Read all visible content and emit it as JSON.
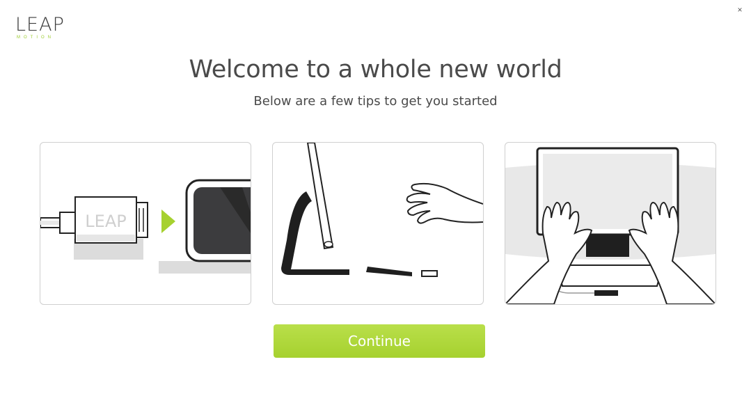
{
  "window": {
    "close_icon": "×"
  },
  "logo": {
    "word": "LEAP",
    "sub": "MOTION"
  },
  "header": {
    "title": "Welcome to a whole new world",
    "subtitle": "Below are a few tips to get you started"
  },
  "tips": [
    {
      "illustration": "usb-plug-into-device",
      "plug_label": "LEAP"
    },
    {
      "illustration": "hand-near-monitor-and-controller"
    },
    {
      "illustration": "hands-over-laptop"
    }
  ],
  "actions": {
    "continue_label": "Continue"
  },
  "colors": {
    "accent": "#a6d12f",
    "text": "#4a4a4a",
    "card_border": "#cfcfcf"
  }
}
